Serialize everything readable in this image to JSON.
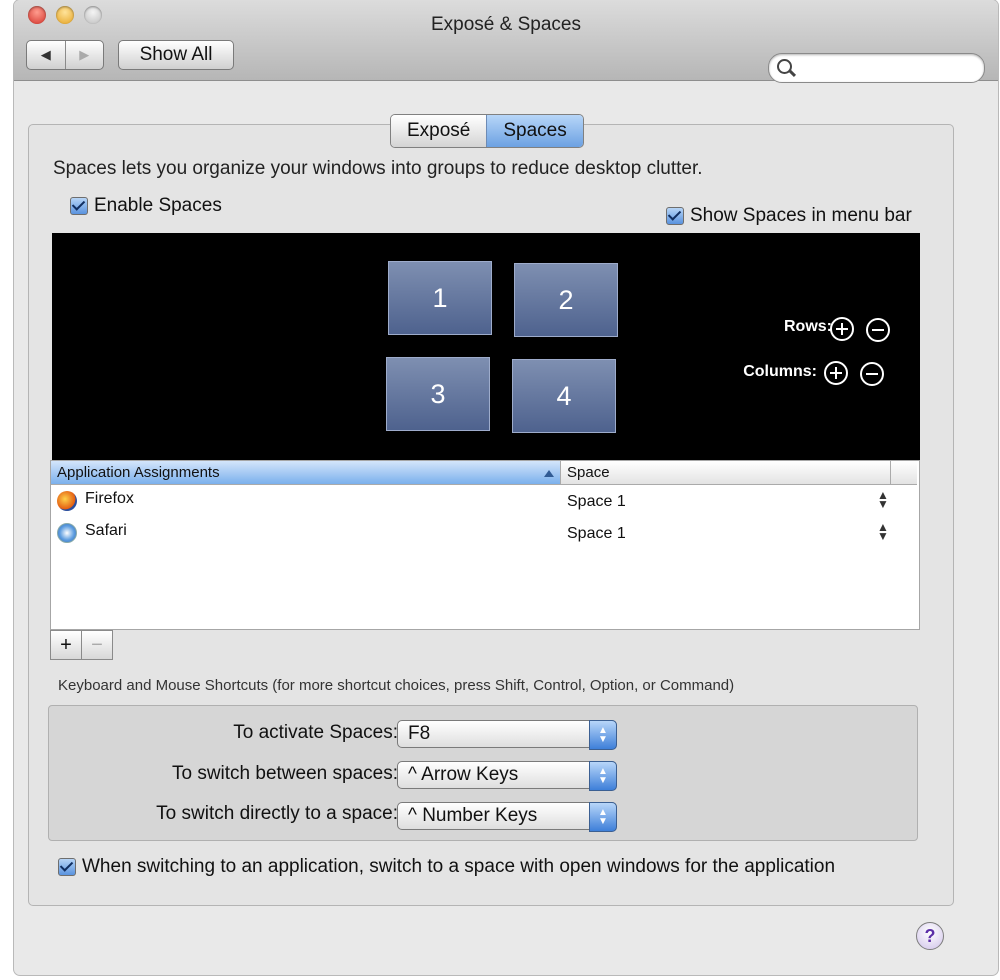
{
  "window": {
    "title": "Exposé & Spaces",
    "show_all": "Show All",
    "back_glyph": "◀",
    "forward_glyph": "▶",
    "search_placeholder": ""
  },
  "tabs": [
    {
      "label": "Exposé",
      "active": false
    },
    {
      "label": "Spaces",
      "active": true
    }
  ],
  "spaces": {
    "description": "Spaces lets you organize your windows into groups to reduce desktop clutter.",
    "enable_label": "Enable Spaces",
    "enable_checked": true,
    "menubar_label": "Show Spaces in menu bar",
    "menubar_checked": true,
    "tiles": [
      "1",
      "2",
      "3",
      "4"
    ],
    "rows_label": "Rows:",
    "columns_label": "Columns:"
  },
  "assignments": {
    "headers": [
      "Application Assignments",
      "Space"
    ],
    "rows": [
      {
        "app": "Firefox",
        "space": "Space 1",
        "icon": "firefox-icon"
      },
      {
        "app": "Safari",
        "space": "Space 1",
        "icon": "safari-icon"
      }
    ],
    "add_glyph": "+",
    "remove_glyph": "−"
  },
  "shortcuts": {
    "title": "Keyboard and Mouse Shortcuts (for more shortcut choices, press Shift, Control, Option, or Command)",
    "items": [
      {
        "label": "To activate Spaces:",
        "value": "F8"
      },
      {
        "label": "To switch between spaces:",
        "value": "^ Arrow Keys"
      },
      {
        "label": "To switch directly to a space:",
        "value": "^ Number Keys"
      }
    ]
  },
  "switch_option": {
    "label": "When switching to an application, switch to a space with open windows for the application",
    "checked": true
  },
  "help": "?"
}
